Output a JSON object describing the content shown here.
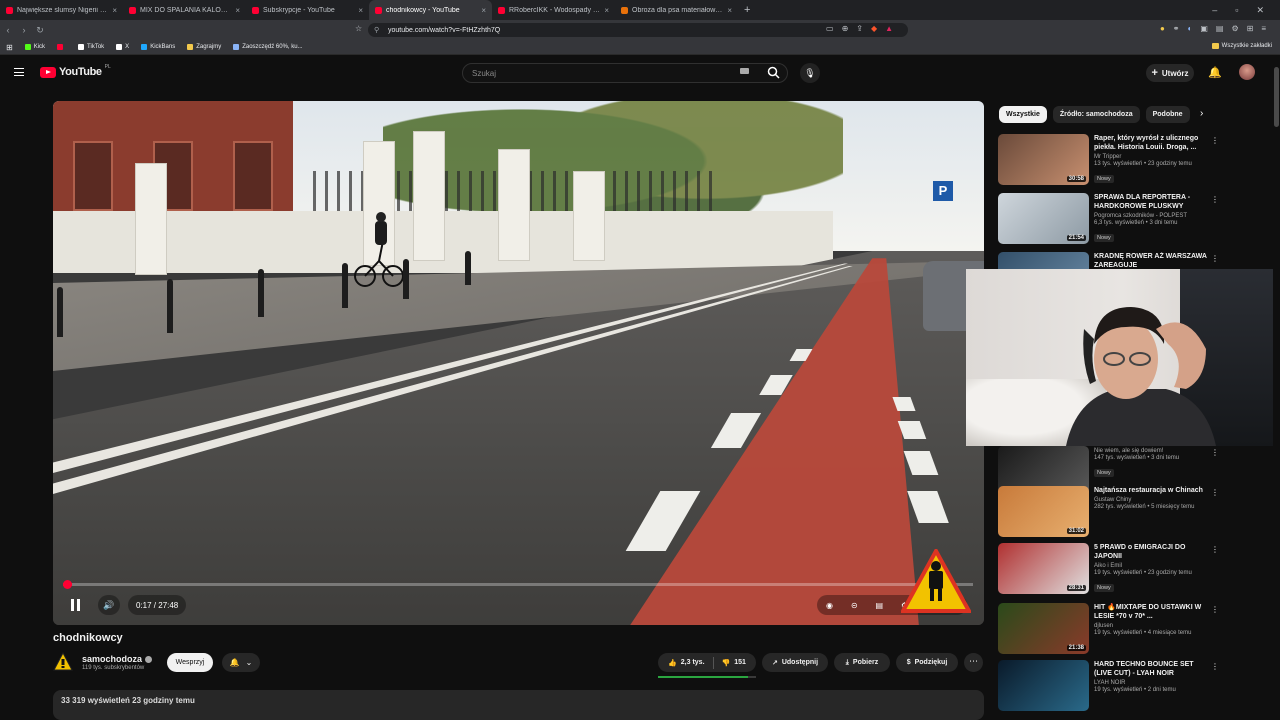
{
  "browser": {
    "tabs": [
      {
        "title": "Największe slumsy Nigerii - YouTube",
        "active": false,
        "favicon": "youtube"
      },
      {
        "title": "MIX DO SPALANIA KALORII NA SIŁOWNI",
        "active": false,
        "favicon": "youtube"
      },
      {
        "title": "Subskrypcje - YouTube",
        "active": false,
        "favicon": "youtube"
      },
      {
        "title": "chodnikowcy - YouTube",
        "active": true,
        "favicon": "youtube"
      },
      {
        "title": "RRobercIKK - Wodospady Meliniary |",
        "active": false,
        "favicon": "youtube"
      },
      {
        "title": "Obroża dla psa materiałowa antyszarp",
        "active": false,
        "favicon": "orange"
      }
    ],
    "url": "youtube.com/watch?v=-FtHZzhth7Q",
    "bookmarks": [
      "Kick",
      "",
      "TikTok",
      "X",
      "KickBans",
      "Zagrajmy",
      "Zaoszczędź 60%, ku..."
    ],
    "bookmarks_all": "Wszystkie zakładki"
  },
  "header": {
    "logo": "YouTube",
    "logo_country": "PL",
    "search_placeholder": "Szukaj",
    "create_label": "Utwórz"
  },
  "player": {
    "current_time": "0:17 / 27:48",
    "progress_fraction": 0.01
  },
  "video": {
    "title": "chodnikowcy",
    "channel": "samochodoza",
    "subscribers": "119 tys. subskrybentów",
    "support_label": "Wesprzyj",
    "likes": "2,3 tys.",
    "dislikes": "151",
    "share_label": "Udostępnij",
    "download_label": "Pobierz",
    "thanks_label": "Podziękuj",
    "desc_peek": "33 319 wyświetleń  23 godziny temu"
  },
  "sidebar": {
    "chips": [
      "Wszystkie",
      "Źródło: samochodoza",
      "Podobne"
    ],
    "recommendations": [
      {
        "title": "Raper, który wyrósł z ulicznego piekła. Historia Louii. Droga, ...",
        "channel": "Mr Tripper",
        "meta": "13 tys. wyświetleń • 23 godziny temu",
        "badge": "Nowy",
        "duration": "30:58",
        "colors": [
          "#6a4a3a",
          "#c89070"
        ]
      },
      {
        "title": "SPRAWA DLA REPORTERA - HARDKOROWE PLUSKWY",
        "channel": "Pogromca szkodników - POLPEST",
        "meta": "6,3 tys. wyświetleń • 3 dni temu",
        "badge": "Nowy",
        "duration": "21:54",
        "colors": [
          "#cfd6dc",
          "#8d9aa4"
        ]
      },
      {
        "title": "KRADNĘ ROWER AŻ WARSZAWA ZAREAGUJE",
        "channel": "",
        "meta": "",
        "badge": "",
        "duration": "",
        "colors": [
          "#33506a",
          "#6a8aa5"
        ]
      },
      {
        "title": "",
        "channel": "Nie wiem, ale się dowiem!",
        "meta": "147 tys. wyświetleń • 3 dni temu",
        "badge": "Nowy",
        "duration": "37:57",
        "colors": [
          "#1a1a1a",
          "#5a5a5a"
        ]
      },
      {
        "title": "Najtańsza restauracja w Chinach",
        "channel": "Gustaw Chiny",
        "meta": "282 tys. wyświetleń • 5 miesięcy temu",
        "badge": "",
        "duration": "31:02",
        "colors": [
          "#c87a3a",
          "#e8b070"
        ]
      },
      {
        "title": "5 PRAWD o EMIGRACJI DO JAPONII",
        "channel": "Aiko i Emil",
        "meta": "19 tys. wyświetleń • 23 godziny temu",
        "badge": "Nowy",
        "duration": "28:31",
        "colors": [
          "#b03030",
          "#e0e0e0"
        ]
      },
      {
        "title": "HIT 🔥MIXTAPE DO USTAWKI W LESIE *70 v 70* ...",
        "channel": "djlusen",
        "meta": "19 tys. wyświetleń • 4 miesiące temu",
        "badge": "",
        "duration": "21:38",
        "colors": [
          "#2a4a1a",
          "#8a3a2a"
        ]
      },
      {
        "title": "HARD TECHNO BOUNCE SET (LIVE CUT) - LYAH NOIR",
        "channel": "LYAH NOIR",
        "meta": "19 tys. wyświetleń • 2 dni temu",
        "badge": "",
        "duration": "",
        "colors": [
          "#0a1a2a",
          "#2a6a8a"
        ]
      }
    ]
  }
}
